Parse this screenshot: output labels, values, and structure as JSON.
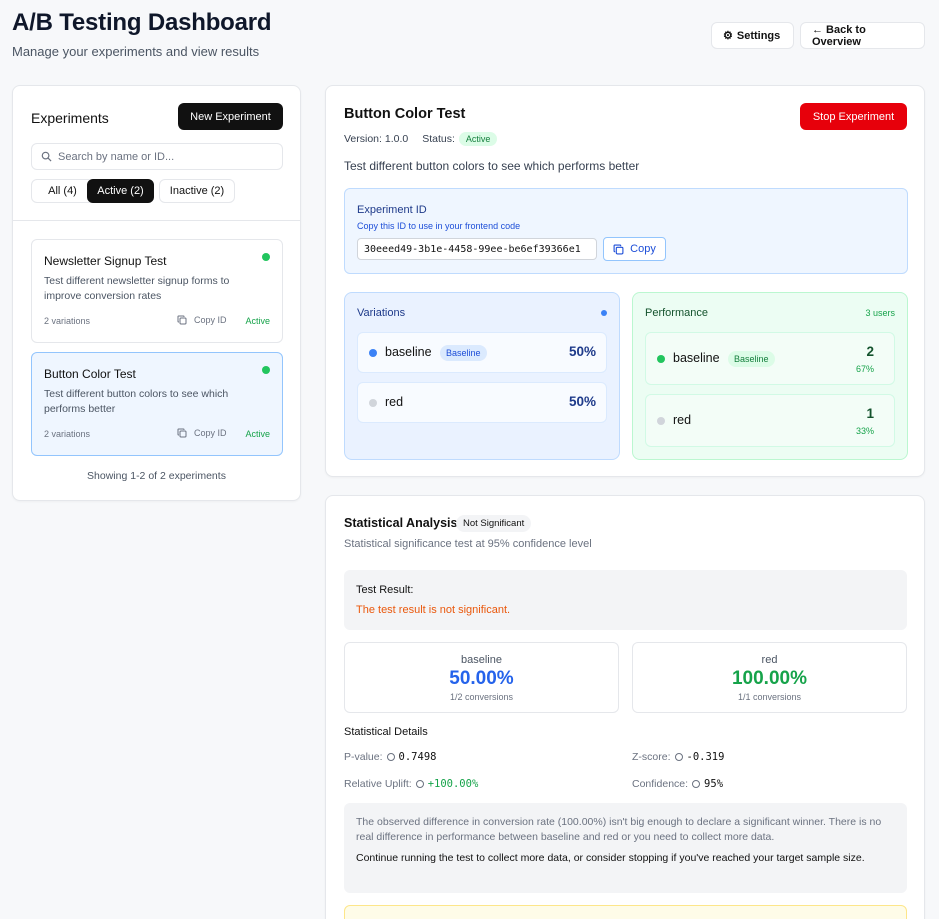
{
  "header": {
    "title": "A/B Testing Dashboard",
    "subtitle": "Manage your experiments and view results",
    "settings_label": "Settings",
    "back_label": "← Back to Overview"
  },
  "sidebar": {
    "title": "Experiments",
    "new_label": "New Experiment",
    "search_placeholder": "Search by name or ID...",
    "filters": [
      {
        "label": "All (4)",
        "active": false
      },
      {
        "label": "Active (2)",
        "active": true
      },
      {
        "label": "Inactive (2)",
        "active": false
      }
    ],
    "experiments": [
      {
        "name": "Newsletter Signup Test",
        "description": "Test different newsletter signup forms to improve conversion rates",
        "variations": "2 variations",
        "copy_label": "Copy ID",
        "status": "Active"
      },
      {
        "name": "Button Color Test",
        "description": "Test different button colors to see which performs better",
        "variations": "2 variations",
        "copy_label": "Copy ID",
        "status": "Active"
      }
    ],
    "showing": "Showing 1-2 of 2 experiments"
  },
  "detail": {
    "title": "Button Color Test",
    "version_label": "Version: 1.0.0",
    "status_label": "Status:",
    "status": "Active",
    "stop_label": "Stop Experiment",
    "description": "Test different button colors to see which performs better",
    "id_box": {
      "title": "Experiment ID",
      "subtitle": "Copy this ID to use in your frontend code",
      "value": "30eeed49-3b1e-4458-99ee-be6ef39366e1",
      "copy_label": "Copy"
    },
    "variations": {
      "title": "Variations",
      "rows": [
        {
          "name": "baseline",
          "badge": "Baseline",
          "pct": "50%"
        },
        {
          "name": "red",
          "badge": "",
          "pct": "50%"
        }
      ]
    },
    "performance": {
      "title": "Performance",
      "users": "3 users",
      "rows": [
        {
          "name": "baseline",
          "badge": "Baseline",
          "count": "2",
          "pct": "67%"
        },
        {
          "name": "red",
          "badge": "",
          "count": "1",
          "pct": "33%"
        }
      ]
    }
  },
  "stats": {
    "title": "Statistical Analysis",
    "badge": "Not Significant",
    "subtitle": "Statistical significance test at 95% confidence level",
    "result_label": "Test Result:",
    "result_value": "The test result is not significant.",
    "metrics": [
      {
        "name": "baseline",
        "rate": "50.00%",
        "conversions": "1/2 conversions",
        "color": "#2563eb"
      },
      {
        "name": "red",
        "rate": "100.00%",
        "conversions": "1/1 conversions",
        "color": "#16a34a"
      }
    ],
    "details_title": "Statistical Details",
    "details": {
      "pvalue_label": "P-value:",
      "pvalue": "0.7498",
      "zscore_label": "Z-score:",
      "zscore": "-0.319",
      "uplift_label": "Relative Uplift:",
      "uplift": "+100.00%",
      "confidence_label": "Confidence:",
      "confidence": "95%"
    },
    "explanation": "The observed difference in conversion rate (100.00%) isn't big enough to declare a significant winner. There is no real difference in performance between baseline and red or you need to collect more data.",
    "recommendation": "Continue running the test to collect more data, or consider stopping if you've reached your target sample size."
  },
  "colors": {
    "active_green": "#22c55e",
    "baseline_blue": "#3b82f6",
    "stop_red": "#e7000b",
    "muted_dot": "#d1d5db"
  }
}
